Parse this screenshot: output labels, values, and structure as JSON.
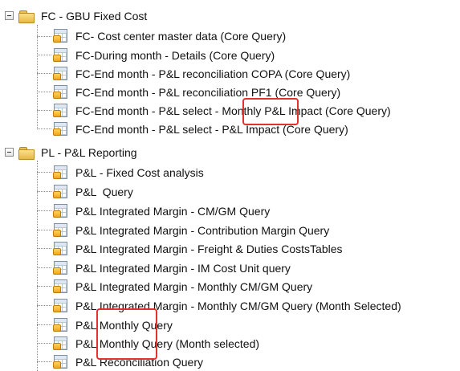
{
  "tree": {
    "groups": [
      {
        "label": "FC - GBU Fixed Cost",
        "icon": "folder-icon",
        "expander": "collapse-icon",
        "items": [
          "FC- Cost center master data (Core Query)",
          "FC-During month - Details (Core Query)",
          "FC-End month - P&L reconciliation COPA (Core Query)",
          "FC-End month - P&L reconciliation PF1 (Core Query)",
          "FC-End month - P&L select - Monthly P&L Impact (Core Query)",
          "FC-End month - P&L select - P&L Impact (Core Query)"
        ]
      },
      {
        "label": "PL - P&L Reporting",
        "icon": "folder-icon",
        "expander": "collapse-icon",
        "items": [
          "P&L - Fixed Cost analysis",
          "P&L  Query",
          "P&L Integrated Margin - CM/GM Query",
          "P&L Integrated Margin - Contribution Margin Query",
          "P&L Integrated Margin - Freight & Duties CostsTables",
          "P&L Integrated Margin - IM Cost Unit query",
          "P&L Integrated Margin - Monthly CM/GM Query",
          "P&L Integrated Margin - Monthly CM/GM Query (Month Selected)",
          "P&L Monthly Query",
          "P&L Monthly Query (Month selected)",
          "P&L Reconciliation Query"
        ]
      }
    ],
    "query_icon": "query-icon"
  },
  "highlight_color": "#e53030"
}
